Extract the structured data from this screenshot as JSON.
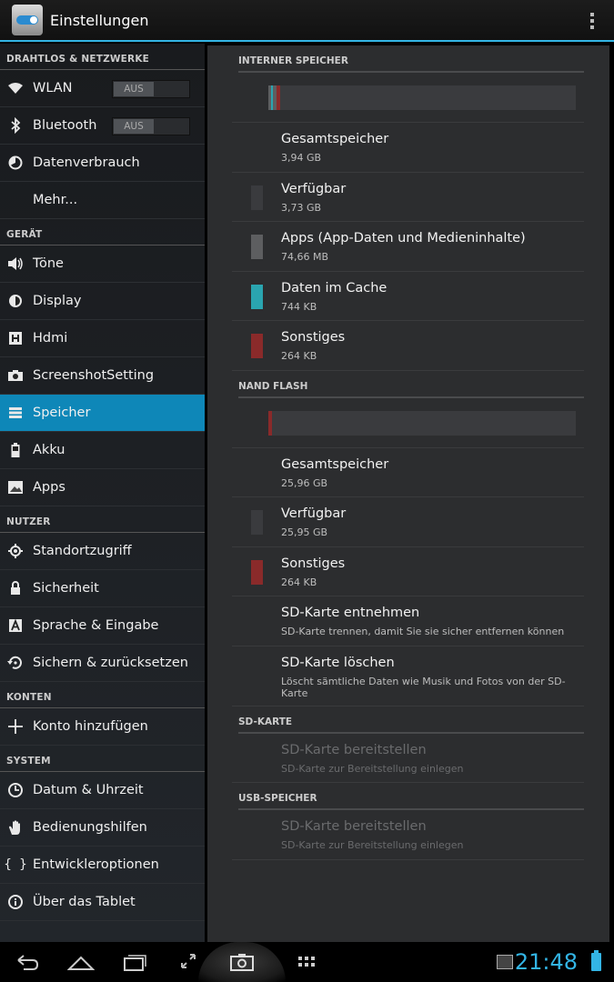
{
  "actionbar": {
    "title": "Einstellungen"
  },
  "sidebar": {
    "sections": [
      {
        "header": "DRAHTLOS & NETZWERKE",
        "items": [
          {
            "label": "WLAN",
            "icon": "wifi-icon",
            "toggle": "AUS"
          },
          {
            "label": "Bluetooth",
            "icon": "bluetooth-icon",
            "toggle": "AUS"
          },
          {
            "label": "Datenverbrauch",
            "icon": "data-usage-icon"
          },
          {
            "label": "Mehr...",
            "icon": ""
          }
        ]
      },
      {
        "header": "GERÄT",
        "items": [
          {
            "label": "Töne",
            "icon": "volume-icon"
          },
          {
            "label": "Display",
            "icon": "brightness-icon"
          },
          {
            "label": "Hdmi",
            "icon": "hdmi-icon"
          },
          {
            "label": "ScreenshotSetting",
            "icon": "camera-icon"
          },
          {
            "label": "Speicher",
            "icon": "storage-icon",
            "active": true
          },
          {
            "label": "Akku",
            "icon": "battery-icon"
          },
          {
            "label": "Apps",
            "icon": "apps-icon"
          }
        ]
      },
      {
        "header": "NUTZER",
        "items": [
          {
            "label": "Standortzugriff",
            "icon": "location-icon"
          },
          {
            "label": "Sicherheit",
            "icon": "lock-icon"
          },
          {
            "label": "Sprache & Eingabe",
            "icon": "language-icon"
          },
          {
            "label": "Sichern & zurücksetzen",
            "icon": "backup-icon"
          }
        ]
      },
      {
        "header": "KONTEN",
        "items": [
          {
            "label": "Konto hinzufügen",
            "icon": "plus-icon"
          }
        ]
      },
      {
        "header": "SYSTEM",
        "items": [
          {
            "label": "Datum & Uhrzeit",
            "icon": "clock-icon"
          },
          {
            "label": "Bedienungshilfen",
            "icon": "hand-icon"
          },
          {
            "label": "Entwickleroptionen",
            "icon": "braces-icon"
          },
          {
            "label": "Über das Tablet",
            "icon": "info-icon"
          }
        ]
      }
    ]
  },
  "storage": {
    "internal": {
      "header": "INTERNER SPEICHER",
      "bar": [
        {
          "fraction": 0.01,
          "color": "#5d5e60"
        },
        {
          "fraction": 0.006,
          "color": "#2aa5b0"
        },
        {
          "fraction": 0.01,
          "color": "#5d5e60"
        },
        {
          "fraction": 0.012,
          "color": "#8a2a2a"
        }
      ],
      "rows": [
        {
          "title": "Gesamtspeicher",
          "sub": "3,94 GB",
          "swatch": ""
        },
        {
          "title": "Verfügbar",
          "sub": "3,73 GB",
          "swatch": "#3a3b3e"
        },
        {
          "title": "Apps (App-Daten und Medieninhalte)",
          "sub": "74,66 MB",
          "swatch": "#5d5e60"
        },
        {
          "title": "Daten im Cache",
          "sub": "744 KB",
          "swatch": "#2aa5b0"
        },
        {
          "title": "Sonstiges",
          "sub": "264 KB",
          "swatch": "#8a2a2a"
        }
      ]
    },
    "nand": {
      "header": "NAND FLASH",
      "bar": [
        {
          "fraction": 0.012,
          "color": "#8a2a2a"
        }
      ],
      "rows": [
        {
          "title": "Gesamtspeicher",
          "sub": "25,96 GB",
          "swatch": ""
        },
        {
          "title": "Verfügbar",
          "sub": "25,95 GB",
          "swatch": "#3a3b3e"
        },
        {
          "title": "Sonstiges",
          "sub": "264 KB",
          "swatch": "#8a2a2a"
        },
        {
          "title": "SD-Karte entnehmen",
          "sub": "SD-Karte trennen, damit Sie sie sicher entfernen können",
          "swatch": ""
        },
        {
          "title": "SD-Karte löschen",
          "sub": "Löscht sämtliche Daten wie Musik und Fotos von der SD-Karte",
          "swatch": "",
          "tall": true
        }
      ]
    },
    "sdcard": {
      "header": "SD-KARTE",
      "rows": [
        {
          "title": "SD-Karte bereitstellen",
          "sub": "SD-Karte zur Bereitstellung einlegen",
          "disabled": true
        }
      ]
    },
    "usb": {
      "header": "USB-SPEICHER",
      "rows": [
        {
          "title": "SD-Karte bereitstellen",
          "sub": "SD-Karte zur Bereitstellung einlegen",
          "disabled": true
        }
      ]
    }
  },
  "statusbar": {
    "time": "21:48"
  },
  "colors": {
    "accent": "#33b5e5",
    "active_item": "#0e87b8"
  }
}
